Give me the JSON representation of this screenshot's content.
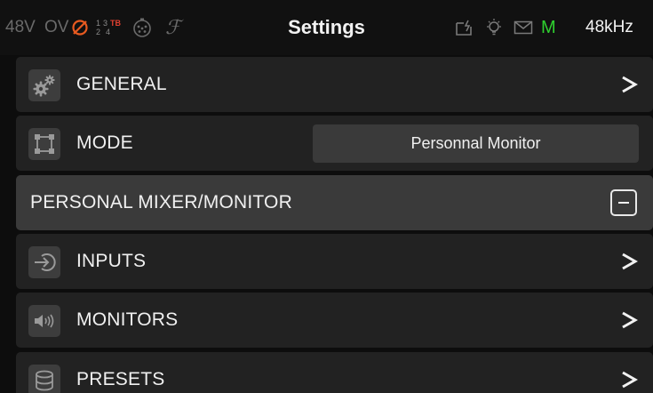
{
  "status": {
    "phantom": "48V",
    "overload": "OV",
    "channels_top": [
      "1",
      "3",
      "TB"
    ],
    "channels_bottom": [
      "2",
      "4"
    ],
    "fx": "ℱ",
    "title": "Settings",
    "mic_indicator": "M",
    "sample_rate": "48kHz"
  },
  "rows": {
    "general": {
      "label": "GENERAL",
      "icon": "gears-icon"
    },
    "mode": {
      "label": "MODE",
      "icon": "mode-frame-icon",
      "value": "Personnal Monitor"
    },
    "section": {
      "label": "PERSONAL MIXER/MONITOR"
    },
    "inputs": {
      "label": "INPUTS",
      "icon": "input-arrow-icon"
    },
    "monitors": {
      "label": "MONITORS",
      "icon": "speaker-icon"
    },
    "presets": {
      "label": "PRESETS",
      "icon": "database-icon"
    }
  },
  "colors": {
    "background": "#0d0d0d",
    "row": "#222222",
    "section": "#3a3a3a",
    "mic_green": "#2fd02f",
    "phase_orange": "#e85a20",
    "talkback_red": "#e04030"
  }
}
